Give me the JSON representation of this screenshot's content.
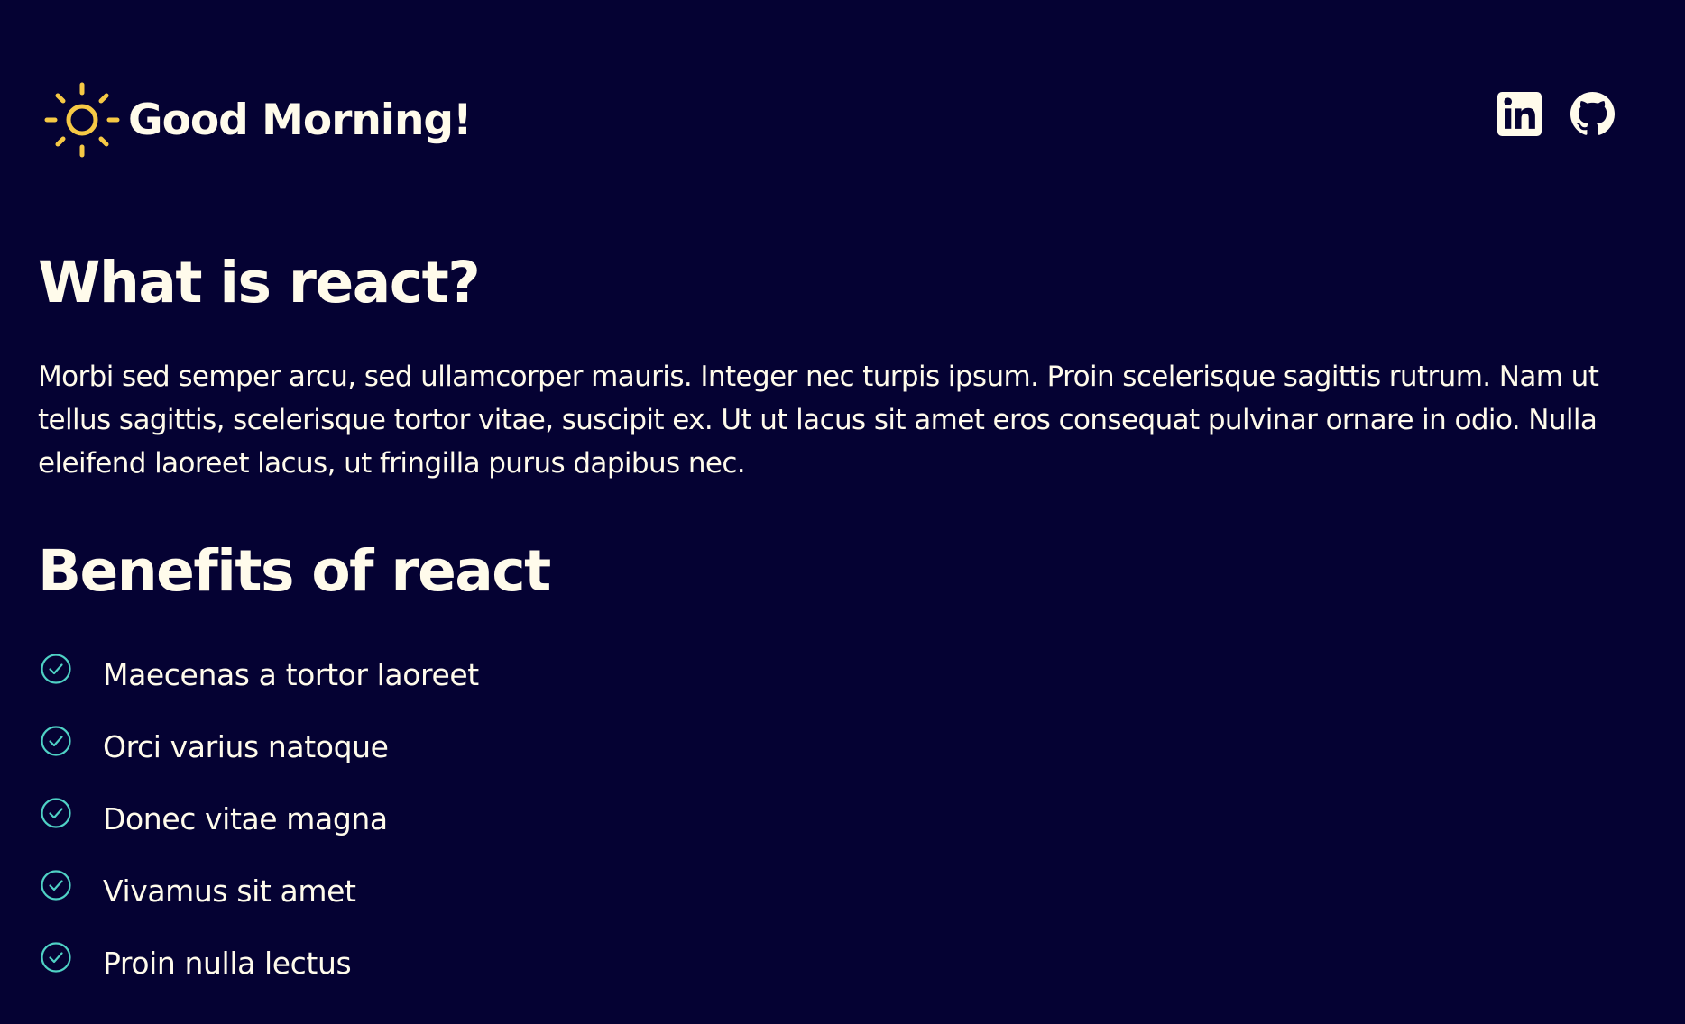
{
  "header": {
    "greeting": "Good Morning!",
    "icon": "sun-icon",
    "socials": [
      {
        "name": "LinkedIn",
        "icon": "linkedin-icon"
      },
      {
        "name": "GitHub",
        "icon": "github-icon"
      }
    ]
  },
  "main": {
    "title": "What is react?",
    "paragraph": "Morbi sed semper arcu, sed ullamcorper mauris. Integer nec turpis ipsum. Proin scelerisque sagittis rutrum. Nam ut tellus sagittis, scelerisque tortor vitae, suscipit ex. Ut ut lacus sit amet eros consequat pulvinar ornare in odio. Nulla eleifend laoreet lacus, ut fringilla purus dapibus nec.",
    "benefits_title": "Benefits of react",
    "benefits": [
      "Maecenas a tortor laoreet",
      "Orci varius natoque",
      "Donec vitae magna",
      "Vivamus sit amet",
      "Proin nulla lectus"
    ]
  },
  "colors": {
    "background": "#050233",
    "text": "#fffbeb",
    "sun": "#f6c945",
    "check": "#4fd1c5"
  }
}
